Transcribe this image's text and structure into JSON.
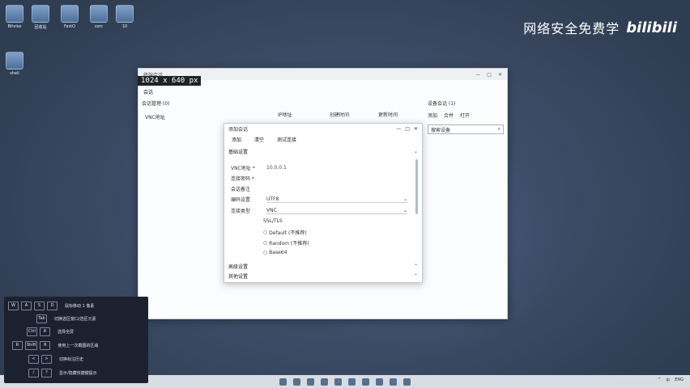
{
  "desktop": {
    "icons": [
      {
        "label": "Bitvise"
      },
      {
        "label": "回收站"
      },
      {
        "label": "FastQ"
      },
      {
        "label": "xsrc"
      },
      {
        "label": "10"
      },
      {
        "label": "shell"
      }
    ],
    "brand_text": "网络安全免费学",
    "brand_logo": "bilibili"
  },
  "window": {
    "title": "终端会话",
    "size_badge": "1024 x 640 px",
    "toolbar_label": "会话",
    "left_panel": {
      "group": "会话管理 (0)",
      "item": "VNC地址"
    },
    "columns": [
      "IP地址",
      "创建时间",
      "更新时间"
    ],
    "right_panel": {
      "title": "设备会话 (1)",
      "actions": [
        "添加",
        "合并",
        "打开"
      ],
      "search_placeholder": "搜索设备"
    }
  },
  "dialog": {
    "title": "添加会话",
    "tools": [
      "添加",
      "清空",
      "测试连接"
    ],
    "basic_section": "基础设置",
    "fields": {
      "vnc_label": "VNC地址 *",
      "vnc_value": "10.0.0.1",
      "conn_label": "连接密码 *",
      "name_label": "会话备注",
      "encoding_label": "编码设置",
      "encoding_value": "UTF8",
      "conn_type_label": "连接类型",
      "conn_type_value": "VNC"
    },
    "options": [
      "SSL/TLS",
      "Default (不推荐)",
      "Random (不推荐)",
      "Base64"
    ],
    "advanced_section": "高级设置",
    "other_section": "其他设置"
  },
  "hints": [
    {
      "keys": [
        "W",
        "A",
        "S",
        "D"
      ],
      "text": "鼠标移动 1 像素"
    },
    {
      "keys": [
        "Tab"
      ],
      "text": "切换选区窗口/选区元素"
    },
    {
      "keys": [
        "Ctrl",
        "A"
      ],
      "text": "选择全屏"
    },
    {
      "keys": [
        "R",
        "Shift",
        "R"
      ],
      "text": "使用上一次截图的区域"
    },
    {
      "keys": [
        "<",
        ">"
      ],
      "text": "切换标注历史"
    },
    {
      "keys": [
        "/",
        "?"
      ],
      "text": "显示/隐藏快捷键提示"
    }
  ],
  "taskbar": {
    "tray": [
      "^",
      "中",
      "ENG"
    ]
  },
  "colors": {
    "desktop": "#3a4a63",
    "badge": "#1f2328",
    "overlay": "#1c2130"
  }
}
